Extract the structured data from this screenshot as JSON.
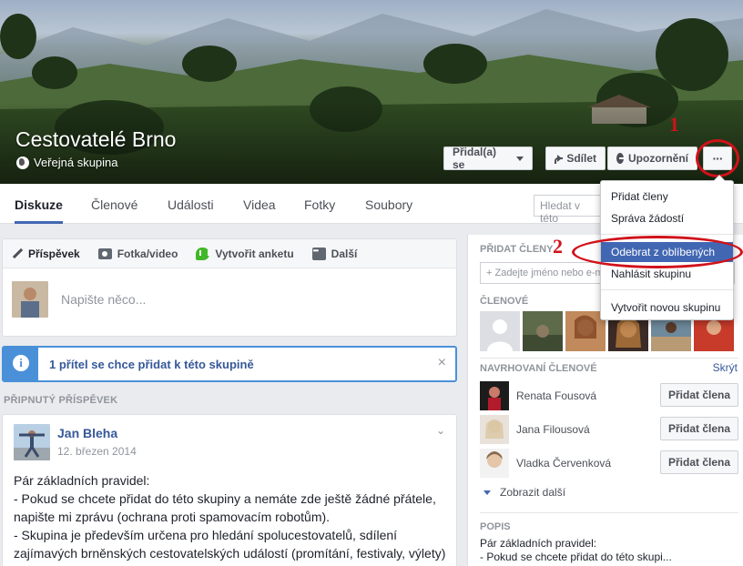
{
  "group": {
    "name": "Cestovatelé Brno",
    "privacy": "Veřejná skupina"
  },
  "cover_buttons": {
    "join": "Přidal(a) se",
    "share": "Sdílet",
    "notifications": "Upozornění",
    "more": "···"
  },
  "annotations": {
    "marker1": "1",
    "marker2": "2",
    "color": "#d0121a"
  },
  "tabs": [
    "Diskuze",
    "Členové",
    "Události",
    "Videa",
    "Fotky",
    "Soubory"
  ],
  "search": {
    "placeholder": "Hledat v této"
  },
  "composer": {
    "tabs": [
      "Příspěvek",
      "Fotka/video",
      "Vytvořit anketu",
      "Další"
    ],
    "placeholder": "Napište něco..."
  },
  "notice": {
    "text": "1 přítel se chce přidat k této skupině",
    "close": "×"
  },
  "pinned": {
    "label": "PŘIPNUTÝ PŘÍSPĚVEK",
    "author": "Jan Bleha",
    "date": "12. březen 2014",
    "body": "Pár základních pravidel:\n- Pokud se chcete přidat do této skupiny a nemáte zde ještě žádné přátele, napište mi zprávu (ochrana proti spamovacím robotům).\n- Skupina je především určena pro hledání spolucestovatelů, sdílení zajímavých brněnských cestovatelských událostí (promítání, festivaly, výlety) a otázky kolem cestování (třeba \" Jak se z Brna nejlaciněji dostat na"
  },
  "sidebar": {
    "add_members_label": "PŘIDAT ČLENY",
    "add_members_placeholder": "+ Zadejte jméno nebo e-mailovou adresu...",
    "members_label": "ČLENOVÉ",
    "suggested_label": "NAVRHOVANÍ ČLENOVÉ",
    "hide": "Skrýt",
    "suggested": [
      {
        "name": "Renata Fousová",
        "button": "Přidat člena"
      },
      {
        "name": "Jana Filousová",
        "button": "Přidat člena"
      },
      {
        "name": "Vladka Červenková",
        "button": "Přidat člena"
      }
    ],
    "show_more": "Zobrazit další",
    "description_label": "POPIS",
    "description_line1": "Pár základních pravidel:",
    "description_line2": "- Pokud se chcete přidat do této skupi..."
  },
  "dropdown": {
    "items": [
      "Přidat členy",
      "Správa žádostí",
      "Odebrat z oblíbených",
      "Nahlásit skupinu",
      "Vytvořit novou skupinu"
    ],
    "highlighted_index": 2
  },
  "colors": {
    "brand": "#4267b2",
    "link": "#365899",
    "notice": "#4a90d9"
  }
}
